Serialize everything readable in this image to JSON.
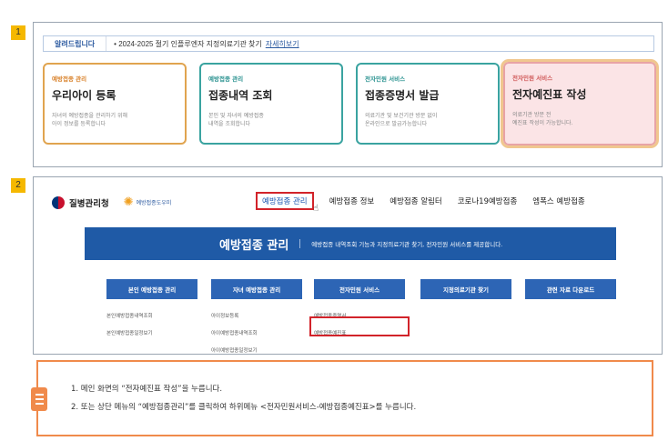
{
  "steps": [
    "1",
    "2"
  ],
  "notice": {
    "tag": "알려드립니다",
    "text": "2024-2025 절기 인플루엔자 지정의료기관 찾기",
    "link": "자세히보기"
  },
  "cards": [
    {
      "category": "예방접종 관리",
      "title": "우리아이 등록",
      "desc1": "자녀의 예방접종을 관리하기 위해",
      "desc2": "아이 정보를 등록합니다"
    },
    {
      "category": "예방접종 관리",
      "title": "접종내역 조회",
      "desc1": "본인 및 자녀의 예방접종",
      "desc2": "내역을 조회합니다"
    },
    {
      "category": "전자민원 서비스",
      "title": "접종증명서 발급",
      "desc1": "의료기관 및 보건기관 방문 없이",
      "desc2": "온라인으로 발급가능합니다"
    },
    {
      "category": "전자민원 서비스",
      "title": "전자예진표 작성",
      "desc1": "의료기관 방문 전",
      "desc2": "예진표 작성이 가능합니다."
    }
  ],
  "site": {
    "agency": "질병관리청",
    "sub_logo": "예방접종도우미"
  },
  "topnav": [
    "예방접종 관리",
    "예방접종 정보",
    "예방접종 알림터",
    "코로나19예방접종",
    "엠폭스 예방접종"
  ],
  "banner": {
    "title": "예방접종 관리",
    "desc": "예방접종 내역조회 기능과 지정의료기관 찾기, 전자민원 서비스를 제공합니다."
  },
  "menu": [
    {
      "label": "본인 예방접종 관리",
      "items": [
        "본인예방접종내역조회",
        "본인예방접종일정보기"
      ]
    },
    {
      "label": "자녀 예방접종 관리",
      "items": [
        "아이정보등록",
        "아이예방접종내역조회",
        "아이예방접종일정보기"
      ]
    },
    {
      "label": "전자민원 서비스",
      "items": [
        "예방접종증명서",
        "예방접종예진표"
      ]
    },
    {
      "label": "지정의료기관 찾기",
      "items": []
    },
    {
      "label": "관련 자료 다운로드",
      "items": []
    }
  ],
  "instructions": [
    "1.  메인 화면의 “전자예진표 작성”을 누릅니다.",
    "2.  또는 상단 메뉴의 “예방접종관리”를 클릭하여 하위메뉴 <전자민원서비스-예방접종예진표>를 누릅니다."
  ],
  "colors": {
    "accent": "#1f5aa6",
    "highlight": "#d2232a",
    "badge": "#f5b800",
    "instruction_border": "#f08a4b"
  }
}
